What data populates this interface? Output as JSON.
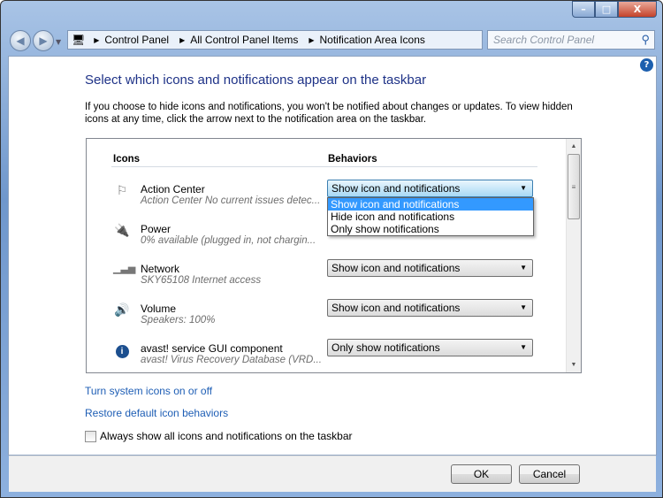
{
  "titlebar": {
    "minimize": "–",
    "maximize": "□",
    "close": "X"
  },
  "address": {
    "crumbs": [
      "Control Panel",
      "All Control Panel Items",
      "Notification Area Icons"
    ]
  },
  "search": {
    "placeholder": "Search Control Panel"
  },
  "page": {
    "title": "Select which icons and notifications appear on the taskbar",
    "intro": "If you choose to hide icons and notifications, you won't be notified about changes or updates. To view hidden icons at any time, click the arrow next to the notification area on the taskbar."
  },
  "table": {
    "col_icons": "Icons",
    "col_behaviors": "Behaviors",
    "rows": [
      {
        "name": "Action Center",
        "sub": "Action Center  No current issues detec...",
        "behavior": "Show icon and notifications",
        "icon": "flag-icon"
      },
      {
        "name": "Power",
        "sub": "0% available (plugged in, not chargin...",
        "behavior": "",
        "icon": "power-icon"
      },
      {
        "name": "Network",
        "sub": "SKY65108 Internet access",
        "behavior": "Show icon and notifications",
        "icon": "network-icon"
      },
      {
        "name": "Volume",
        "sub": "Speakers: 100%",
        "behavior": "Show icon and notifications",
        "icon": "volume-icon"
      },
      {
        "name": "avast! service GUI component",
        "sub": "avast! Virus Recovery Database (VRD...",
        "behavior": "Only show notifications",
        "icon": "info-icon"
      }
    ],
    "dropdown_options": [
      "Show icon and notifications",
      "Hide icon and notifications",
      "Only show notifications"
    ],
    "dropdown_highlighted": "Show icon and notifications"
  },
  "links": {
    "system_icons": "Turn system icons on or off",
    "restore": "Restore default icon behaviors"
  },
  "checkbox": {
    "label": "Always show all icons and notifications on the taskbar",
    "checked": false
  },
  "buttons": {
    "ok": "OK",
    "cancel": "Cancel"
  },
  "colors": {
    "link": "#1e5eb5",
    "title": "#1e3287",
    "highlight": "#3399ff"
  }
}
